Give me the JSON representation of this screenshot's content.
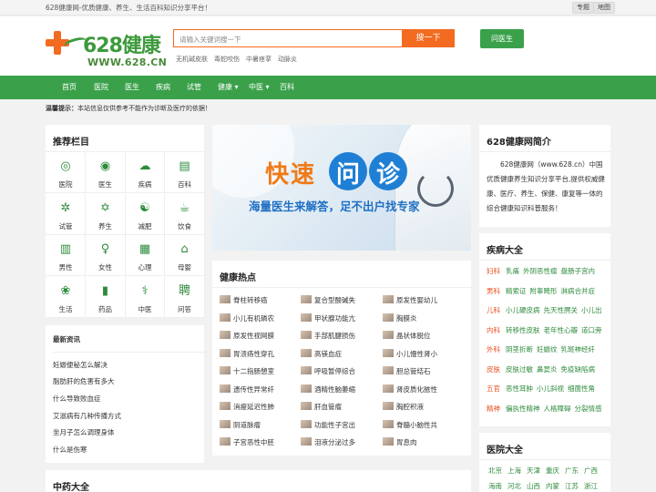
{
  "topbar": {
    "slogan": "628健康网-优质健康、养生、生活百科知识分享平台！",
    "btn1": "专题",
    "btn2": "地图"
  },
  "logo": {
    "brand": "628健康",
    "url": "WWW.628.CN"
  },
  "search": {
    "placeholder": "请输入关键词搜一下",
    "button": "搜一下",
    "hot": [
      "无机碱皮肤",
      "毒蛇咬伤",
      "中暑痉挛",
      "动脉炎"
    ]
  },
  "ask_button": "问医生",
  "nav": [
    "首页",
    "医院",
    "医生",
    "疾病",
    "试管",
    "健康 ▾",
    "中医 ▾",
    "百科"
  ],
  "notice": {
    "label": "温馨提示：",
    "text": "本站信息仅供参考不能作为诊断及医疗的依据！"
  },
  "recommend": {
    "title": "推荐栏目",
    "items": [
      {
        "label": "医院",
        "icon": "film-reel-icon",
        "glyph": "◎"
      },
      {
        "label": "医生",
        "icon": "person-badge-icon",
        "glyph": "◉"
      },
      {
        "label": "疾病",
        "icon": "cloud-download-icon",
        "glyph": "☁"
      },
      {
        "label": "百科",
        "icon": "doc-search-icon",
        "glyph": "▤"
      },
      {
        "label": "试管",
        "icon": "dharma-wheel-icon",
        "glyph": "✲"
      },
      {
        "label": "养生",
        "icon": "star-of-david-icon",
        "glyph": "✡"
      },
      {
        "label": "减肥",
        "icon": "yin-yang-icon",
        "glyph": "☯"
      },
      {
        "label": "饮食",
        "icon": "cup-icon",
        "glyph": "☕"
      },
      {
        "label": "男性",
        "icon": "building-icon",
        "glyph": "▥"
      },
      {
        "label": "女性",
        "icon": "person-icon",
        "glyph": "♀"
      },
      {
        "label": "心理",
        "icon": "newspaper-icon",
        "glyph": "▦"
      },
      {
        "label": "母婴",
        "icon": "baby-icon",
        "glyph": "⌂"
      },
      {
        "label": "生活",
        "icon": "lifebuoy-icon",
        "glyph": "❀"
      },
      {
        "label": "药品",
        "icon": "bar-chart-icon",
        "glyph": "▮"
      },
      {
        "label": "中医",
        "icon": "caduceus-icon",
        "glyph": "⚕"
      },
      {
        "label": "问答",
        "icon": "seal-icon",
        "glyph": "聘"
      }
    ]
  },
  "news": {
    "title": "最新资讯",
    "items": [
      "妊娠便秘怎么解决",
      "脂肪肝的危害有多大",
      "什么导致败血症",
      "艾滋病有几种传播方式",
      "坐月子怎么调理身体",
      "什么是伤寒"
    ]
  },
  "banner": {
    "big1": "快速",
    "big2": "问",
    "big3": "诊",
    "sub": "海量医生来解答，足不出户找专家"
  },
  "hot": {
    "title": "健康热点",
    "items": [
      "脊柱转移癌",
      "复合型酸碱失",
      "原发性婴幼儿",
      "小儿有机磷农",
      "甲状腺功能亢",
      "胸膜炎",
      "原发性视网膜",
      "手部肌腱损伤",
      "晶状体脱位",
      "胃溃疡性穿孔",
      "高镁血症",
      "小儿慢性肾小",
      "十二指肠憩室",
      "呼吸暂停综合",
      "胆总管结石",
      "遗传性异常纤",
      "酒精性脑萎缩",
      "肾皮质化脓性",
      "消瘦延迟性肺",
      "肝血管瘤",
      "胸腔积液",
      "阴道脉瘤",
      "功能性子宫出",
      "脊髓小脑性共",
      "子宫恶性中胚",
      "泪液分泌过多",
      "胃息肉"
    ]
  },
  "intro": {
    "title": "628健康网简介",
    "text": "628健康网（www.628.cn）中国优质健康养生知识分享平台,提供权威健康、医疗、养生、保健、康复等一体的综合健康知识科普服务！"
  },
  "diseases": {
    "title": "疾病大全",
    "rows": [
      {
        "cat": "妇科",
        "items": [
          "乳痛",
          "外阴恶性瘤",
          "盘肠子宫内"
        ]
      },
      {
        "cat": "男科",
        "items": [
          "精索证",
          "附睾畸形",
          "淋病合并症"
        ]
      },
      {
        "cat": "儿科",
        "items": [
          "小儿硬皮病",
          "先天性腭关",
          "小儿出"
        ]
      },
      {
        "cat": "内科",
        "items": [
          "转移性皮肤",
          "老年性心瓣",
          "道口旁"
        ]
      },
      {
        "cat": "外科",
        "items": [
          "阴茎折断",
          "妊娠纹",
          "乳斑神经纤"
        ]
      },
      {
        "cat": "皮肤",
        "items": [
          "皮肤过敏",
          "鼻窦炎",
          "免疫缺陷病"
        ]
      },
      {
        "cat": "五官",
        "items": [
          "恶性耳肿",
          "小儿斜视",
          "细菌性角"
        ]
      },
      {
        "cat": "精神",
        "items": [
          "偏执性精神",
          "人格障碍",
          "分裂情感"
        ]
      }
    ]
  },
  "hospitals": {
    "title": "医院大全",
    "row1": [
      "北京",
      "上海",
      "天津",
      "重庆",
      "广东",
      "广西"
    ],
    "row2": [
      "海南",
      "河北",
      "山西",
      "内蒙",
      "江苏",
      "浙江"
    ]
  },
  "herbs": {
    "title": "中药大全"
  }
}
